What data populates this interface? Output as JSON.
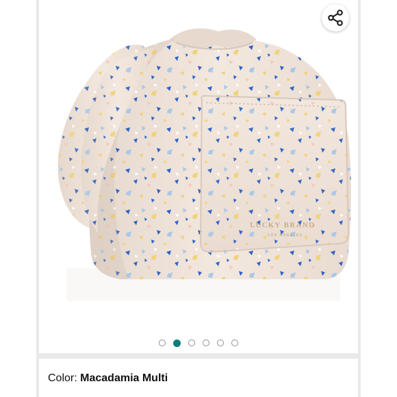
{
  "product": {
    "image_alt": "Lucky Brand drawstring cosmetic pouch with terrazzo print",
    "brand_print": "LUCKY BRAND",
    "brand_subprint": "LOS ANGELES"
  },
  "share": {
    "icon": "share-icon"
  },
  "carousel": {
    "total": 6,
    "active_index": 1
  },
  "color": {
    "label": "Color:",
    "value": "Macadamia Multi"
  },
  "colors": {
    "accent": "#0f7b7d",
    "bag": "#f1e5dc",
    "speckle_blue": "#2f63c4",
    "speckle_light_blue": "#a9c8e6",
    "speckle_yellow": "#f0d27a"
  }
}
